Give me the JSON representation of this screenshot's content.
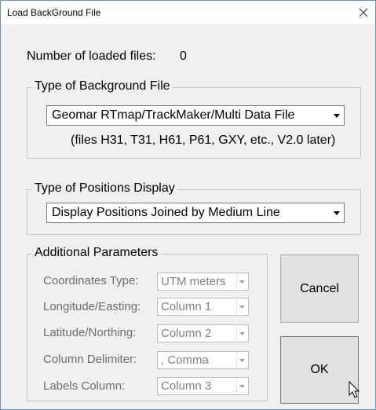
{
  "window": {
    "title": "Load BackGround File",
    "close_glyph": "✕"
  },
  "loaded": {
    "label": "Number of loaded files:",
    "count": "0"
  },
  "background_type": {
    "group_title": "Type of Background File",
    "selected": "Geomar RTmap/TrackMaker/Multi Data File",
    "hint": "(files H31, T31, H61, P61, GXY, etc., V2.0  later)"
  },
  "positions_display": {
    "group_title": "Type of Positions Display",
    "selected": "Display Positions Joined by Medium Line"
  },
  "additional": {
    "group_title": "Additional Parameters",
    "rows": [
      {
        "label": "Coordinates Type:",
        "value": "UTM meters"
      },
      {
        "label": "Longitude/Easting:",
        "value": "Column 1"
      },
      {
        "label": "Latitude/Northing:",
        "value": "Column 2"
      },
      {
        "label": "Column Delimiter:",
        "value": ", Comma"
      },
      {
        "label": "Labels Column:",
        "value": "Column 3"
      }
    ]
  },
  "buttons": {
    "cancel": "Cancel",
    "ok": "OK"
  },
  "icons": {
    "close": "close-icon",
    "dropdown": "chevron-down-icon",
    "cursor": "mouse-pointer-icon"
  },
  "colors": {
    "window_bg": "#f0f0f0",
    "title_bg": "#ffffff",
    "border": "#6d8fb3",
    "disabled_text": "#808080"
  }
}
